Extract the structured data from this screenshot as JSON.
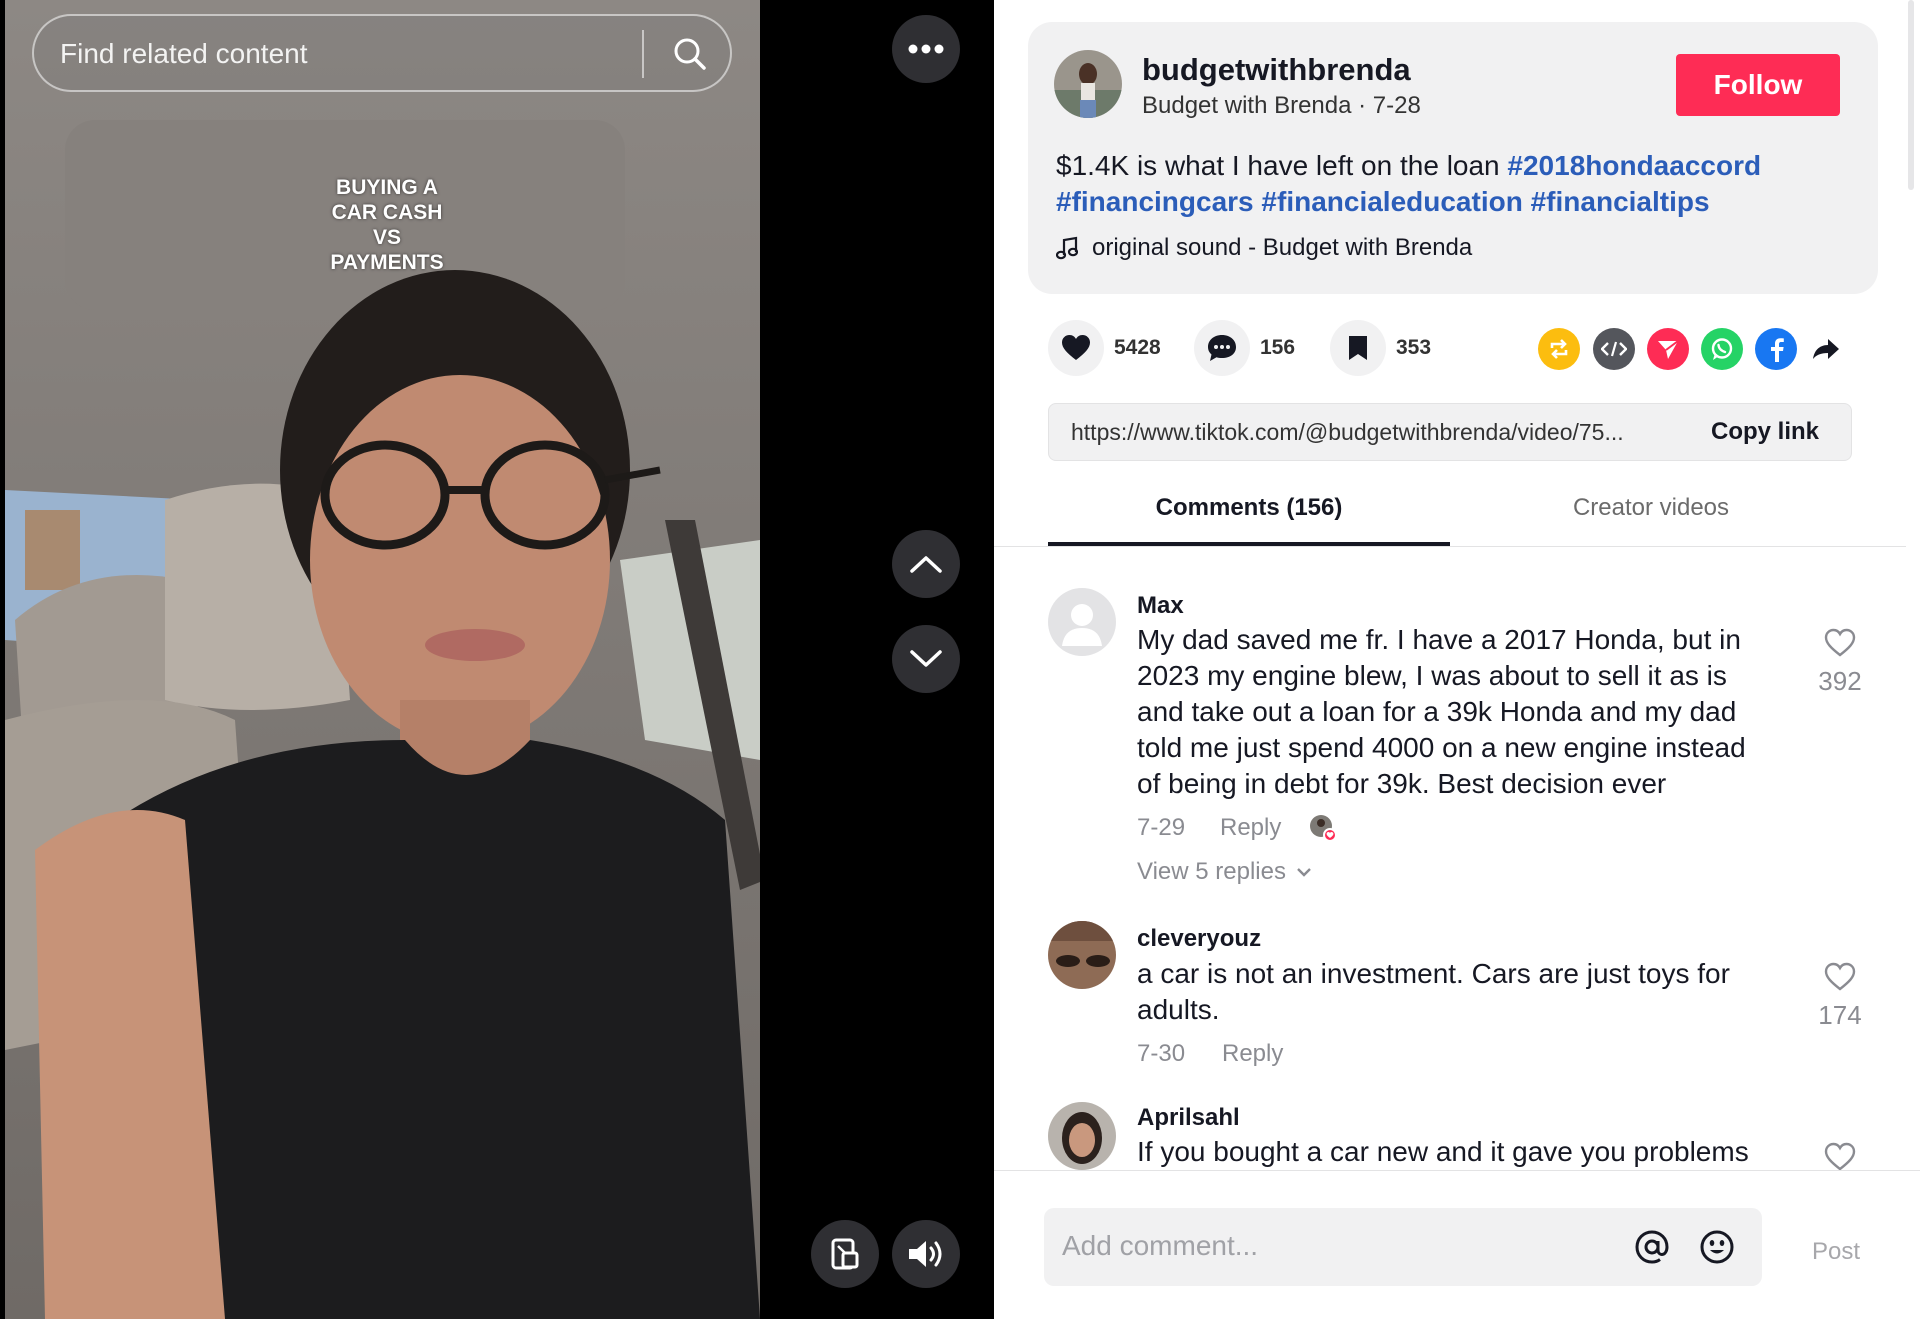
{
  "search": {
    "placeholder": "Find related content"
  },
  "video_overlay_lines": [
    "BUYING A",
    "CAR CASH",
    "VS",
    "PAYMENTS"
  ],
  "post": {
    "username": "budgetwithbrenda",
    "display_name": "Budget with Brenda",
    "date": "7-28",
    "subline": "Budget with Brenda · 7-28",
    "follow_label": "Follow",
    "caption_text": "$1.4K is what I have left on the loan",
    "hashtags": [
      "#2018hondaaccord",
      "#financingcars",
      "#financialeducation",
      "#financialtips"
    ],
    "sound": "original sound - Budget with Brenda"
  },
  "stats": {
    "likes": "5428",
    "comments": "156",
    "saves": "353"
  },
  "share_icons": [
    "repost-icon",
    "embed-icon",
    "send-to-friends-icon",
    "whatsapp-icon",
    "facebook-icon",
    "share-arrow-icon"
  ],
  "link": {
    "url": "https://www.tiktok.com/@budgetwithbrenda/video/75...",
    "copy_label": "Copy link"
  },
  "tabs": [
    {
      "label": "Comments (156)",
      "active": true
    },
    {
      "label": "Creator videos",
      "active": false
    }
  ],
  "comments": [
    {
      "author": "Max",
      "text": "My dad saved me fr. I have a 2017 Honda, but in 2023 my engine blew, I was about to sell it as is and take out a loan for a 39k Honda and my dad told me just spend 4000 on a new engine instead of being in debt for 39k. Best decision ever",
      "date": "7-29",
      "reply_label": "Reply",
      "likes": "392",
      "view_replies": "View 5 replies"
    },
    {
      "author": "cleveryouz",
      "text": "a car is not an investment. Cars are just toys for adults.",
      "date": "7-30",
      "reply_label": "Reply",
      "likes": "174"
    },
    {
      "author": "Aprilsahl",
      "text": "If you bought a car new and it gave you problems"
    }
  ],
  "composer": {
    "placeholder": "Add comment...",
    "post_label": "Post"
  },
  "colors": {
    "follow": "#fe2c55",
    "hashtag": "#2b5db9",
    "repost": "#fcbd0f",
    "embed": "#54565c",
    "send": "#fe2c55",
    "whatsapp": "#25d366",
    "facebook": "#1877f2"
  }
}
